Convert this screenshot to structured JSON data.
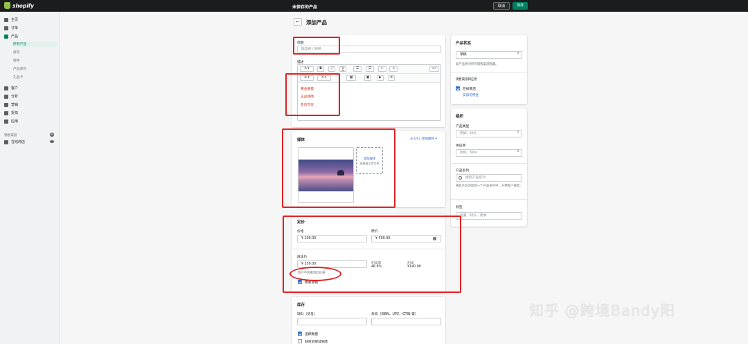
{
  "topbar": {
    "logo_text": "shopify",
    "unsaved": "未保存的产品",
    "cancel": "取消",
    "save": "保存"
  },
  "sidebar": {
    "items": [
      "主页",
      "订单",
      "产品",
      "客户",
      "分析",
      "营销",
      "折扣",
      "应用"
    ],
    "product_subitems": [
      "所有产品",
      "库存",
      "转移",
      "产品系列",
      "礼品卡"
    ],
    "channels_label": "销售渠道",
    "online_store": "在线商店"
  },
  "page": {
    "title": "添加产品",
    "back": "←"
  },
  "title_card": {
    "title_label": "标题",
    "title_placeholder": "欧蓝格 / 短裤",
    "desc_label": "描述",
    "toolbar_font_a": "A",
    "toolbar_bold": "B",
    "toolbar_italic": "I",
    "toolbar_underline": "U",
    "toolbar_code": "<>",
    "toolbar_align": "≡",
    "toolbar_color": "A",
    "desc_lines": [
      "黄金质量",
      "正品保障",
      "售后无忧"
    ]
  },
  "media_card": {
    "heading": "媒体",
    "url_link": "从 URL 添加媒体 ▾",
    "add_media": "添加媒体",
    "drop_hint": "或拖放上传文件"
  },
  "pricing_card": {
    "heading": "定价",
    "price_label": "价格",
    "price_value": "¥  299.00",
    "compare_label": "原价",
    "compare_value": "¥  599.00",
    "cost_label": "成本价",
    "cost_value": "¥  159.00",
    "cost_hint": "客户不会看到此价格",
    "margin_label": "利润率",
    "margin_value": "46.8%",
    "profit_label": "利润",
    "profit_value": "¥140.00",
    "tax_label": "需要收税",
    "tax_checked": true
  },
  "inventory_card": {
    "heading": "库存",
    "sku_label": "SKU（货号）",
    "barcode_label": "条码（ISBN、UPC、GTIN 等）",
    "track_label": "追踪数量",
    "track_checked": true,
    "oos_label": "缺货后继续销售",
    "oos_checked": false
  },
  "status_card": {
    "heading": "产品状态",
    "status_value": "草稿",
    "status_hint": "此产品将对所有销售渠道隐藏。",
    "channels_label": "销售渠道和应用",
    "online_store": "在线商店",
    "schedule_link": "安排可用性"
  },
  "org_card": {
    "heading": "组织",
    "type_label": "产品类型",
    "type_placeholder": "例如，衬衫",
    "vendor_label": "供应商",
    "vendor_placeholder": "例如，Nike",
    "collection_label": "产品系列",
    "collection_placeholder": "搜索产品系列",
    "collection_hint": "将此产品添加到一个产品系列中，方便客户搜索。",
    "tags_label": "标签",
    "tags_placeholder": "古董、衬衫、夏季"
  },
  "watermark": "知乎 @跨境Bandy阳"
}
